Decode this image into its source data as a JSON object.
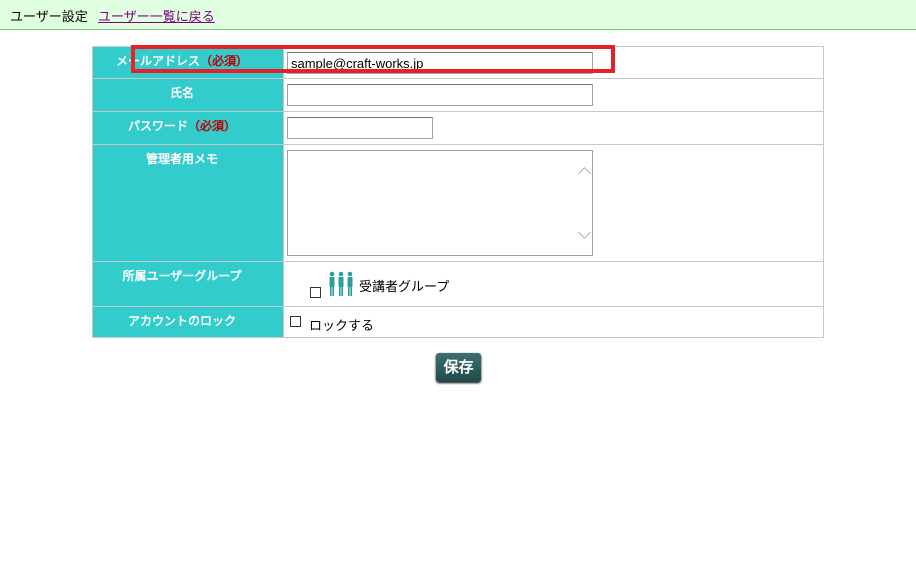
{
  "header": {
    "title": "ユーザー設定",
    "back_link": "ユーザー一覧に戻る"
  },
  "form": {
    "email": {
      "label": "メールアドレス",
      "required": "（必須）",
      "value": "sample@craft-works.jp"
    },
    "name": {
      "label": "氏名",
      "value": ""
    },
    "password": {
      "label": "パスワード",
      "required": "（必須）",
      "value": ""
    },
    "memo": {
      "label": "管理者用メモ",
      "value": ""
    },
    "groups": {
      "label": "所属ユーザーグループ",
      "items": [
        {
          "label": "受講者グループ",
          "checked": false
        }
      ]
    },
    "lock": {
      "label": "アカウントのロック",
      "option": "ロックする",
      "checked": false
    }
  },
  "actions": {
    "save": "保存"
  },
  "colors": {
    "label_bg": "#33cccc",
    "highlight": "#e8202a",
    "save_bg": "#2f5f5f",
    "header_bg": "#e0ffe0"
  }
}
